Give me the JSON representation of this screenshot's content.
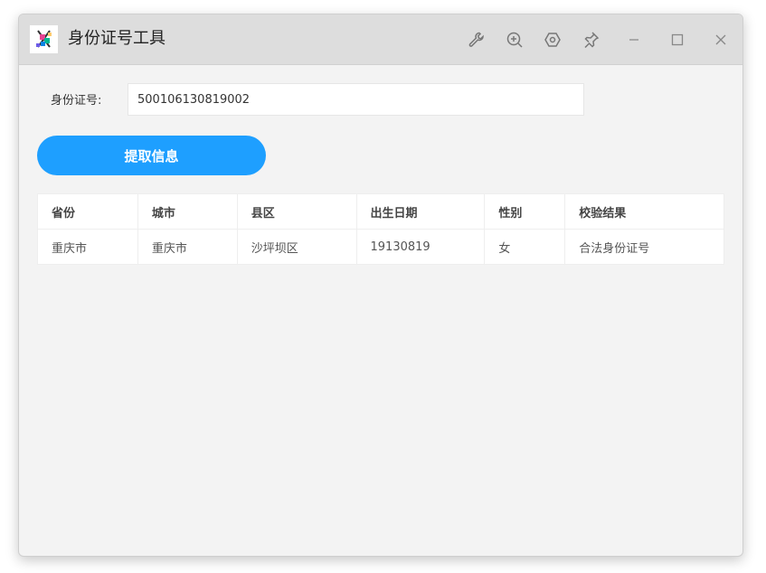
{
  "window": {
    "title": "身份证号工具"
  },
  "titlebar_buttons": [
    {
      "name": "wrench-icon"
    },
    {
      "name": "zoom-in-icon"
    },
    {
      "name": "settings-icon"
    },
    {
      "name": "pin-icon"
    },
    {
      "name": "minimize-icon"
    },
    {
      "name": "maximize-icon"
    },
    {
      "name": "close-icon"
    }
  ],
  "form": {
    "id_label": "身份证号:",
    "id_value": "500106130819002",
    "submit_label": "提取信息"
  },
  "table": {
    "headers": [
      "省份",
      "城市",
      "县区",
      "出生日期",
      "性别",
      "校验结果"
    ],
    "rows": [
      [
        "重庆市",
        "重庆市",
        "沙坪坝区",
        "19130819",
        "女",
        "合法身份证号"
      ]
    ]
  },
  "colors": {
    "accent": "#1e9fff",
    "window_bg": "#f3f3f3",
    "titlebar_bg": "#dddddd"
  }
}
